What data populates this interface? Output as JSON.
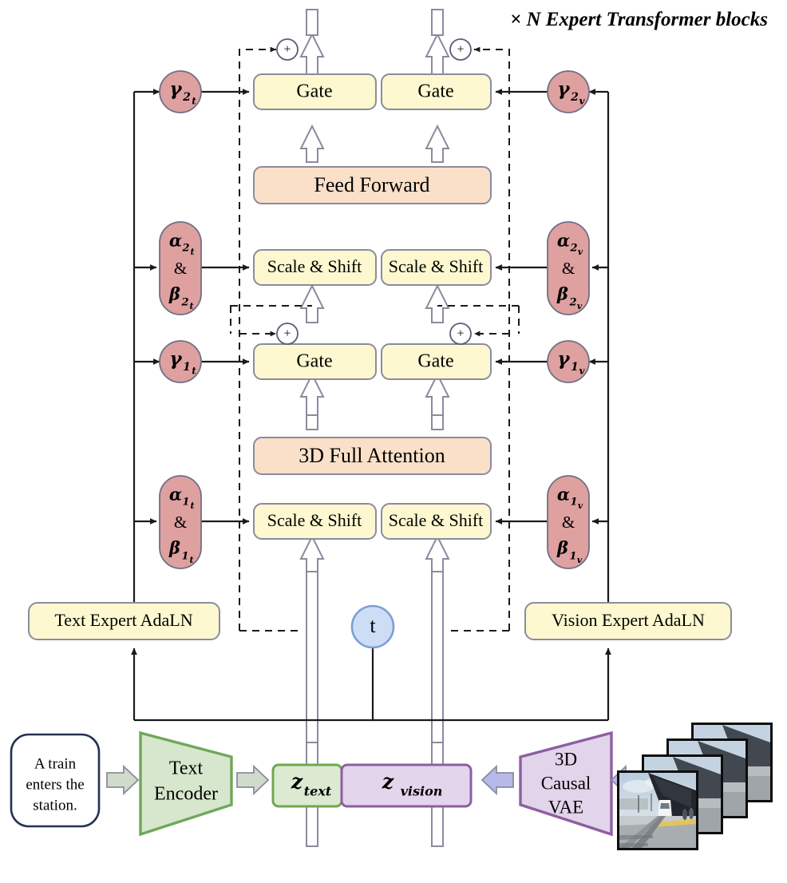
{
  "figure": {
    "title": "× N Expert Transformer blocks",
    "background": "#ffffff"
  },
  "colors": {
    "gate_fill": "#fdf8cf",
    "gate_stroke": "#8b8b9e",
    "scale_shift_fill": "#fdf8cf",
    "core_fill": "#fae0c8",
    "core_stroke": "#8b8b9e",
    "modulation_fill": "#dfa0a0",
    "modulation_stroke": "#6f6f84",
    "adaln_fill": "#fdf8cf",
    "timestep_fill": "#ccddf5",
    "timestep_stroke": "#7b9fd4",
    "text_encoder_fill": "#d7e7cd",
    "text_encoder_stroke": "#71a75b",
    "vae_fill": "#e2d4ea",
    "vae_stroke": "#8e5ea2",
    "z_text_fill": "#dcead1",
    "z_text_stroke": "#6fa84f",
    "z_vision_fill": "#e3d5ec",
    "z_vision_stroke": "#8e5ea2",
    "prompt_stroke": "#23314f",
    "hollow_arrow_stroke": "#8b8b9e",
    "block_arrow_text": "#b9cbb3",
    "block_arrow_vision": "#b7b9e8",
    "line": "#1a1a1a"
  },
  "transformer_block": {
    "gates": [
      {
        "label": "Gate",
        "branch": "text",
        "level": "attention"
      },
      {
        "label": "Gate",
        "branch": "vision",
        "level": "attention"
      },
      {
        "label": "Gate",
        "branch": "text",
        "level": "feedforward"
      },
      {
        "label": "Gate",
        "branch": "vision",
        "level": "feedforward"
      }
    ],
    "scale_shift": [
      {
        "label": "Scale & Shift",
        "branch": "text",
        "level": "attention"
      },
      {
        "label": "Scale & Shift",
        "branch": "vision",
        "level": "attention"
      },
      {
        "label": "Scale & Shift",
        "branch": "text",
        "level": "feedforward"
      },
      {
        "label": "Scale & Shift",
        "branch": "vision",
        "level": "feedforward"
      }
    ],
    "core_modules": [
      {
        "label": "Feed Forward"
      },
      {
        "label": "3D Full Attention"
      }
    ],
    "residual_adders": [
      {
        "label": "+",
        "branch": "text",
        "level": "feedforward"
      },
      {
        "label": "+",
        "branch": "vision",
        "level": "feedforward"
      },
      {
        "label": "+",
        "branch": "text",
        "level": "attention"
      },
      {
        "label": "+",
        "branch": "vision",
        "level": "attention"
      }
    ]
  },
  "modulation": {
    "text": {
      "gamma2": {
        "base": "γ",
        "sub_num": "2",
        "sub_mod": "t"
      },
      "gamma1": {
        "base": "γ",
        "sub_num": "1",
        "sub_mod": "t"
      },
      "alpha_beta_2": {
        "alpha": "α",
        "alpha_num": "2",
        "alpha_mod": "t",
        "amp": "&",
        "beta": "β",
        "beta_num": "2",
        "beta_mod": "t"
      },
      "alpha_beta_1": {
        "alpha": "α",
        "alpha_num": "1",
        "alpha_mod": "t",
        "amp": "&",
        "beta": "β",
        "beta_num": "1",
        "beta_mod": "t"
      }
    },
    "vision": {
      "gamma2": {
        "base": "γ",
        "sub_num": "2",
        "sub_mod": "v"
      },
      "gamma1": {
        "base": "γ",
        "sub_num": "1",
        "sub_mod": "v"
      },
      "alpha_beta_2": {
        "alpha": "α",
        "alpha_num": "2",
        "alpha_mod": "v",
        "amp": "&",
        "beta": "β",
        "beta_num": "2",
        "beta_mod": "v"
      },
      "alpha_beta_1": {
        "alpha": "α",
        "alpha_num": "1",
        "alpha_mod": "v",
        "amp": "&",
        "beta": "β",
        "beta_num": "1",
        "beta_mod": "v"
      }
    }
  },
  "adaln": {
    "text": "Text Expert AdaLN",
    "vision": "Vision Expert AdaLN"
  },
  "timestep": {
    "label": "t"
  },
  "inputs": {
    "prompt": {
      "line1": "A train",
      "line2": "enters the",
      "line3": "station."
    },
    "text_encoder": {
      "line1": "Text",
      "line2": "Encoder"
    },
    "vae": {
      "line1": "3D",
      "line2": "Causal",
      "line3": "VAE"
    },
    "latents": {
      "text": {
        "base": "z",
        "sub": "text"
      },
      "vision": {
        "base": "z",
        "sub": "vision"
      }
    },
    "video_frames": {
      "count": 4,
      "description": "train station platform frames"
    }
  }
}
